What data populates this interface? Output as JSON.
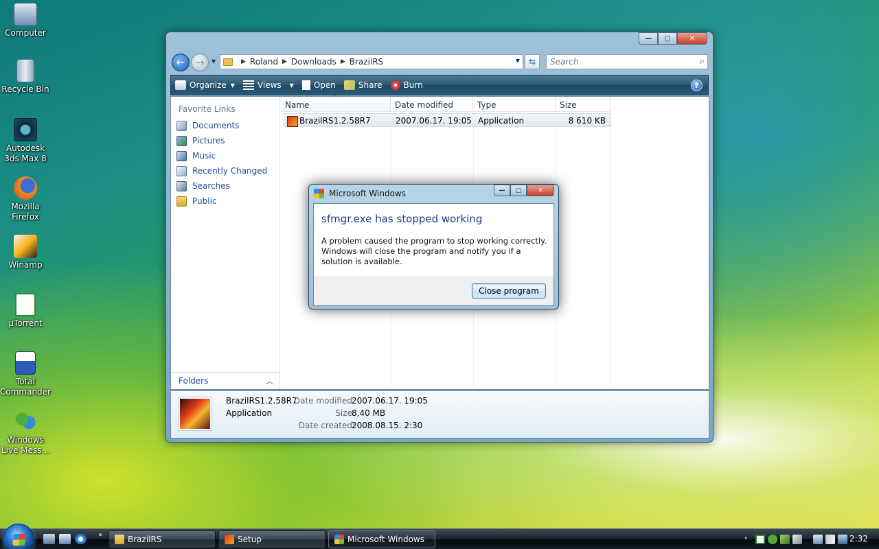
{
  "desktop": {
    "icons": [
      {
        "label": "Computer"
      },
      {
        "label": "Recycle Bin"
      },
      {
        "label": "Autodesk 3ds Max 8"
      },
      {
        "label": "Mozilla Firefox"
      },
      {
        "label": "Winamp"
      },
      {
        "label": "µTorrent"
      },
      {
        "label": "Total Commander"
      },
      {
        "label": "Windows Live Mess..."
      }
    ]
  },
  "explorer": {
    "breadcrumb": [
      "Roland",
      "Downloads",
      "BrazilRS"
    ],
    "search_placeholder": "Search",
    "toolbar": {
      "organize": "Organize",
      "views": "Views",
      "open": "Open",
      "share": "Share",
      "burn": "Burn"
    },
    "nav_pane": {
      "title": "Favorite Links",
      "items": [
        "Documents",
        "Pictures",
        "Music",
        "Recently Changed",
        "Searches",
        "Public"
      ],
      "folders_label": "Folders"
    },
    "columns": [
      "Name",
      "Date modified",
      "Type",
      "Size"
    ],
    "files": [
      {
        "name": "BrazilRS1.2.58R7",
        "date": "2007.06.17. 19:05",
        "type": "Application",
        "size": "8 610 KB"
      }
    ],
    "details": {
      "name": "BrazilRS1.2.58R7",
      "type": "Application",
      "date_modified_label": "Date modified:",
      "date_modified": "2007.06.17. 19:05",
      "size_label": "Size:",
      "size": "8,40 MB",
      "date_created_label": "Date created:",
      "date_created": "2008.08.15. 2:30"
    }
  },
  "dialog": {
    "title": "Microsoft Windows",
    "heading": "sfmgr.exe has stopped working",
    "message": "A problem caused the program to stop working correctly. Windows will close the program and notify you if a solution is available.",
    "button": "Close program"
  },
  "taskbar": {
    "tasks": [
      "BrazilRS",
      "Setup",
      "Microsoft Windows"
    ],
    "clock": "2:32"
  },
  "colors": {
    "link_blue": "#1e4e9a",
    "heading_blue": "#1a3a8a"
  }
}
